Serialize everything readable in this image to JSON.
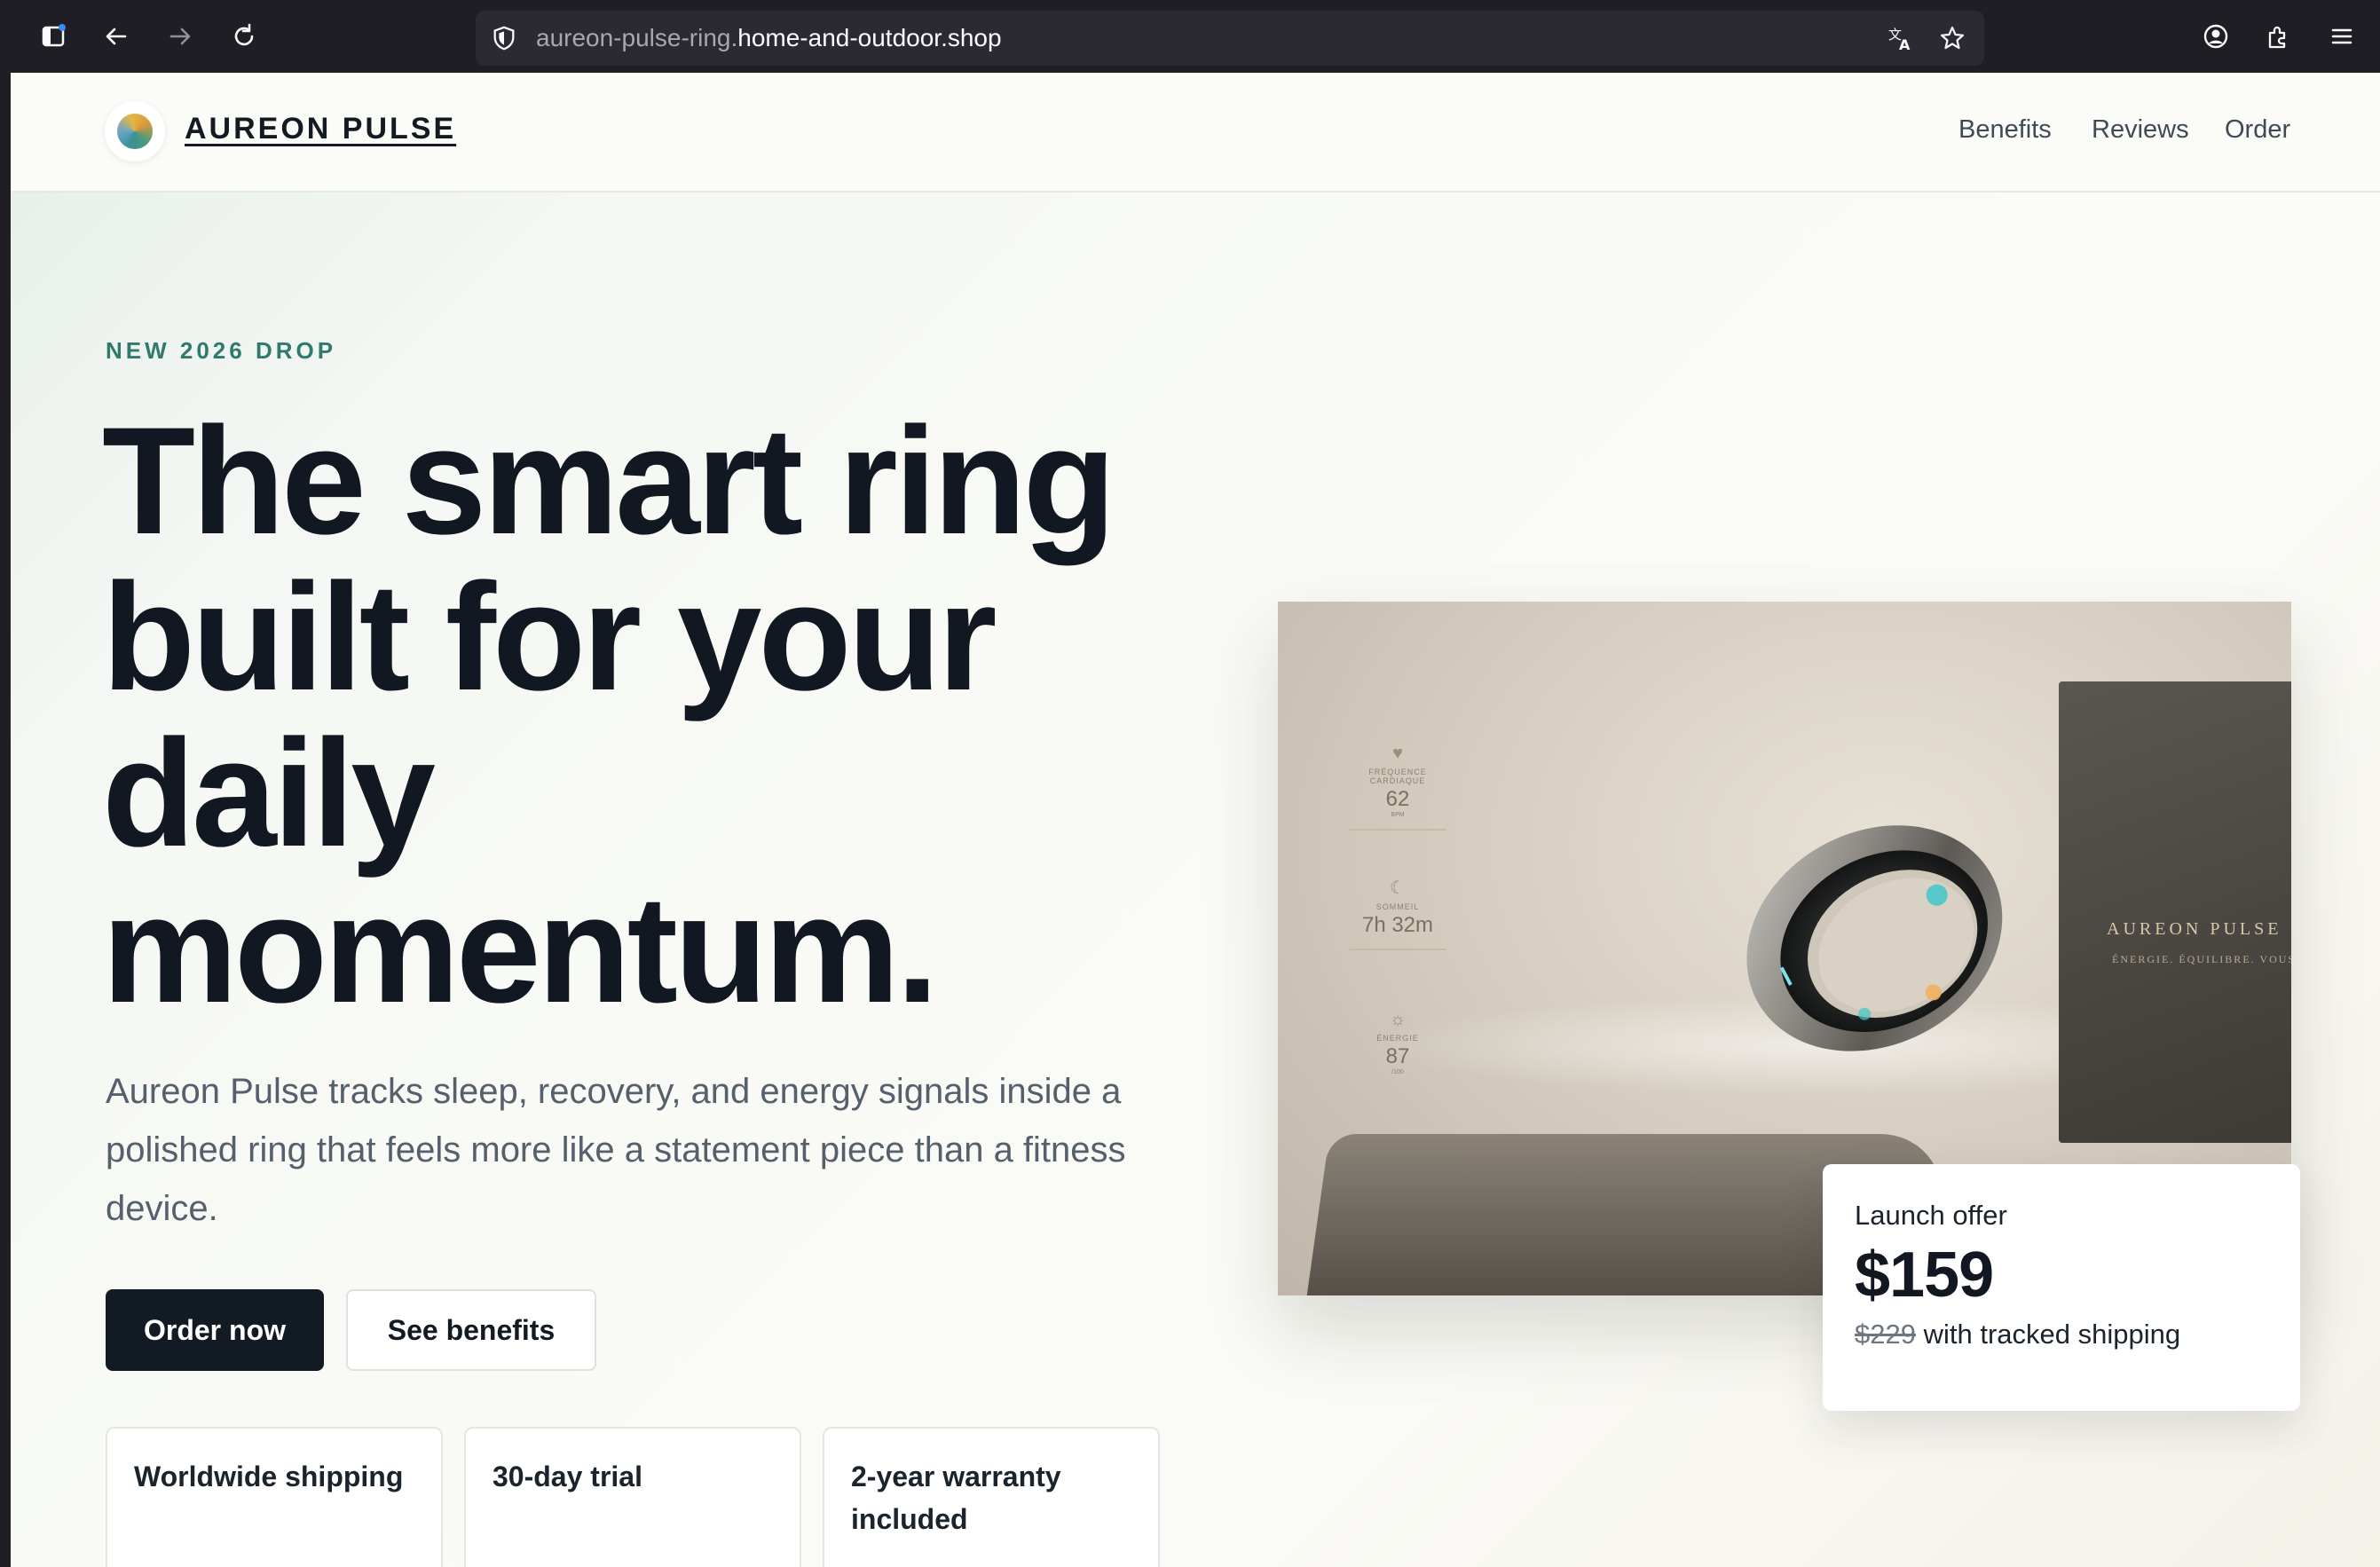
{
  "browser": {
    "url_subdomain": "aureon-pulse-ring.",
    "url_domain": "home-and-outdoor.shop",
    "icons": [
      "sidebar-icon",
      "back-icon",
      "forward-icon",
      "reload-icon",
      "shield-icon",
      "translate-icon",
      "bookmark-star-icon",
      "account-icon",
      "extensions-icon",
      "menu-icon"
    ]
  },
  "header": {
    "brand": "AUREON PULSE",
    "nav": [
      "Benefits",
      "Reviews",
      "Order"
    ]
  },
  "hero": {
    "eyebrow": "NEW 2026 DROP",
    "headline_lines": [
      "The smart ring",
      "built for your",
      "daily",
      "momentum."
    ],
    "lede": "Aureon Pulse tracks sleep, recovery, and energy signals inside a polished ring that feels more like a statement piece than a fitness device.",
    "cta_primary": "Order now",
    "cta_secondary": "See benefits",
    "features": [
      "Worldwide shipping",
      "30-day trial",
      "2-year warranty included"
    ]
  },
  "product_image": {
    "metrics": [
      {
        "label": "FRÉQUENCE CARDIAQUE",
        "value": "62",
        "unit": "BPM"
      },
      {
        "label": "SOMMEIL",
        "value": "7h 32m",
        "unit": ""
      },
      {
        "label": "ÉNERGIE",
        "value": "87",
        "unit": "/100"
      }
    ],
    "box_title": "AUREON PULSE",
    "box_tagline": "ÉNERGIE. ÉQUILIBRE. VOUS."
  },
  "offer": {
    "label": "Launch offer",
    "price": "$159",
    "old_price": "$229",
    "note": "with tracked shipping"
  },
  "colors": {
    "accent": "#2f7a6c",
    "ink": "#111821",
    "chrome": "#1f1e24"
  }
}
